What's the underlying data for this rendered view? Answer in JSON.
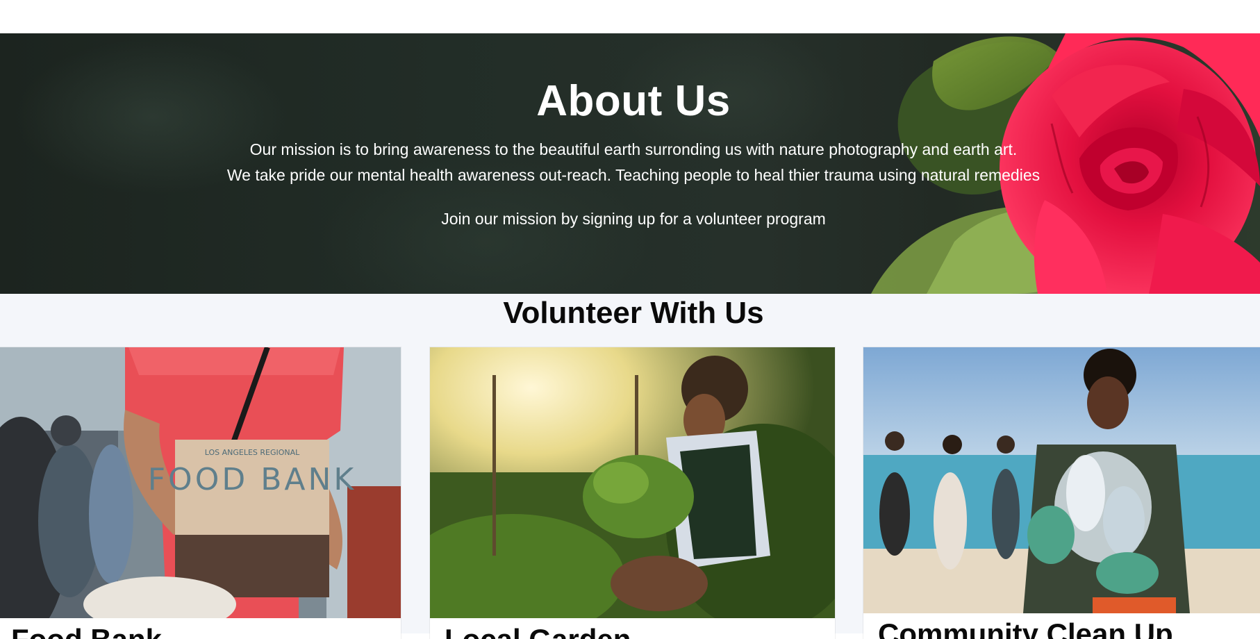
{
  "hero": {
    "title": "About Us",
    "line1": "Our mission is to bring awareness to the beautiful earth surronding us with nature photography and earth art.",
    "line2": "We take pride our mental health awareness out-reach. Teaching people to heal thier trauma using natural remedies",
    "line3": "Join our mission by signing up for a volunteer program",
    "decor_image": "red-rose-with-green-leaves"
  },
  "volunteer": {
    "title": "Volunteer With Us",
    "cards": [
      {
        "title": "Food Bank",
        "image": "person-holding-food-bank-box",
        "box_text_top": "LOS ANGELES REGIONAL",
        "box_text_main": "FOOD BANK"
      },
      {
        "title": "Local Garden",
        "image": "woman-gardening-at-sunset"
      },
      {
        "title": "Community Clean Up",
        "image": "volunteers-cleaning-beach-holding-plastic-bottles"
      }
    ]
  },
  "colors": {
    "hero_bg": "#222d27",
    "section_bg": "#f4f6fa",
    "rose": "#e3103f",
    "text_light": "#ffffff",
    "text_dark": "#0a0a0a"
  }
}
